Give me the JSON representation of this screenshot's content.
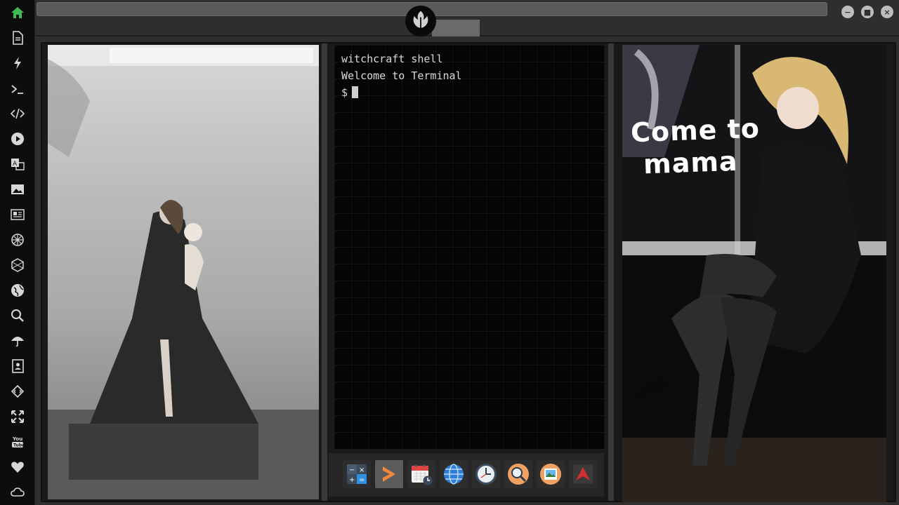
{
  "sidebar": {
    "items": [
      {
        "icon": "home-icon",
        "color": "#3fb950"
      },
      {
        "icon": "document-icon"
      },
      {
        "icon": "lightning-icon"
      },
      {
        "icon": "terminal-icon"
      },
      {
        "icon": "code-icon"
      },
      {
        "icon": "play-icon"
      },
      {
        "icon": "translate-icon"
      },
      {
        "icon": "image-icon"
      },
      {
        "icon": "news-icon"
      },
      {
        "icon": "settings-wheel-icon"
      },
      {
        "icon": "cube-icon"
      },
      {
        "icon": "globe-icon"
      },
      {
        "icon": "search-icon"
      },
      {
        "icon": "umbrella-icon"
      },
      {
        "icon": "contacts-icon"
      },
      {
        "icon": "dev-icon"
      },
      {
        "icon": "fullscreen-icon"
      },
      {
        "icon": "youtube-icon"
      },
      {
        "icon": "heart-icon"
      },
      {
        "icon": "cloud-icon"
      }
    ]
  },
  "window_controls": {
    "minimize": "−",
    "maximize": "■",
    "close": "×"
  },
  "terminal": {
    "lines": [
      "witchcraft shell",
      "Welcome to Terminal"
    ],
    "prompt": "$"
  },
  "right_image": {
    "caption_line1": "Come to",
    "caption_line2": "mama"
  },
  "dock": {
    "items": [
      {
        "icon": "calculator-icon"
      },
      {
        "icon": "sublime-text-icon"
      },
      {
        "icon": "calendar-icon"
      },
      {
        "icon": "browser-globe-icon"
      },
      {
        "icon": "clock-icon"
      },
      {
        "icon": "search-magnifier-icon"
      },
      {
        "icon": "image-viewer-icon"
      },
      {
        "icon": "app-launcher-icon"
      }
    ]
  },
  "colors": {
    "accent_green": "#3fb950",
    "sublime_orange": "#f0883e",
    "red_logo": "#d32f2f"
  }
}
